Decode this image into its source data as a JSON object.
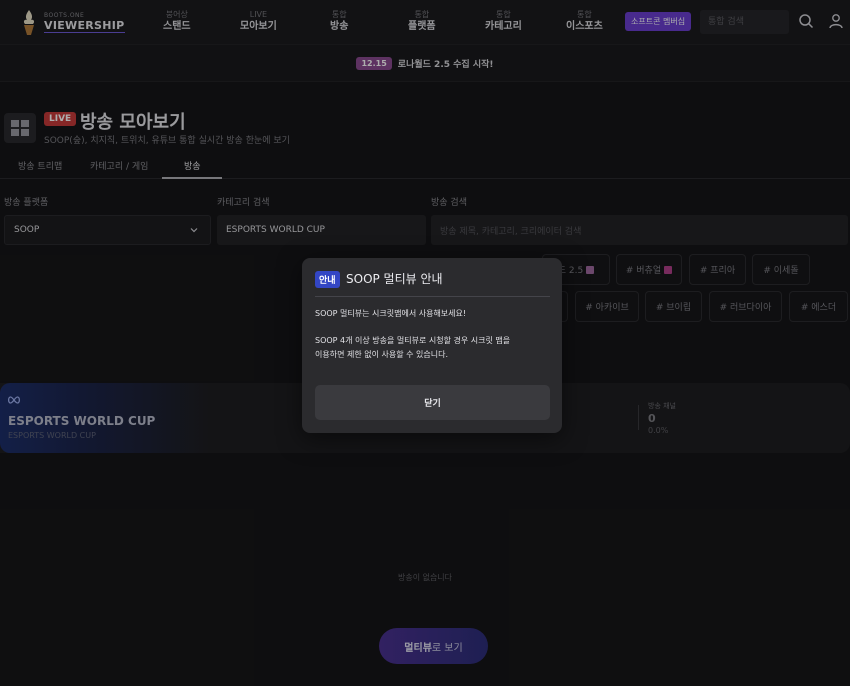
{
  "header": {
    "logo_small": "BOOTS.ONE",
    "logo_big": "VIEWERSHIP",
    "nav": [
      {
        "top": "붕어상",
        "main": "스탠드"
      },
      {
        "top": "LIVE",
        "main": "모아보기"
      },
      {
        "top": "통합",
        "main": "방송"
      },
      {
        "top": "통합",
        "main": "플랫폼"
      },
      {
        "top": "통합",
        "main": "카테고리"
      },
      {
        "top": "통합",
        "main": "이스포츠"
      }
    ],
    "membership_label": "소프트콘 멤버십",
    "search_placeholder": "통합 검색"
  },
  "notice": {
    "date": "12.15",
    "text": "로나월드 2.5 수집 시작!"
  },
  "page": {
    "live_badge": "LIVE",
    "title": "방송 모아보기",
    "subtitle": "SOOP(숲), 치지직, 트위치, 유튜브 통합 실시간 방송 한눈에 보기"
  },
  "tabs": [
    "방송 트리맵",
    "카테고리 / 게임",
    "방송"
  ],
  "filters": {
    "platform_label": "방송 플랫폼",
    "platform_value": "SOOP",
    "category_label": "카테고리 검색",
    "category_value": "ESPORTS WORLD CUP",
    "broadcast_label": "방송 검색",
    "broadcast_placeholder": "방송 제목, 카테고리, 크리에이터 검색"
  },
  "tags": {
    "row1": [
      "드 2.5",
      "# 버츄얼",
      "# 프리아",
      "# 이세돌"
    ],
    "row2": [
      "# 아카이브",
      "# 브이립",
      "# 러브다이아",
      "# 에스더"
    ]
  },
  "category": {
    "name": "ESPORTS WORLD CUP",
    "sub": "ESPORTS WORLD CUP",
    "stat_label": "방송 채널",
    "stat_value": "0",
    "stat_pct": "0.0%"
  },
  "empty_text": "방송이 없습니다",
  "multiview": {
    "strong": "멀티뷰",
    "rest": "로 보기"
  },
  "modal": {
    "badge": "안내",
    "title": "SOOP 멀티뷰 안내",
    "line1": "SOOP 멀티뷰는 시크릿맵에서 사용해보세요!",
    "line2": "SOOP 4개 이상 방송을 멀티뷰로 시청할 경우 시크릿 맵을",
    "line3": "이용하면 제한 없이 사용할 수 있습니다.",
    "close_label": "닫기"
  }
}
